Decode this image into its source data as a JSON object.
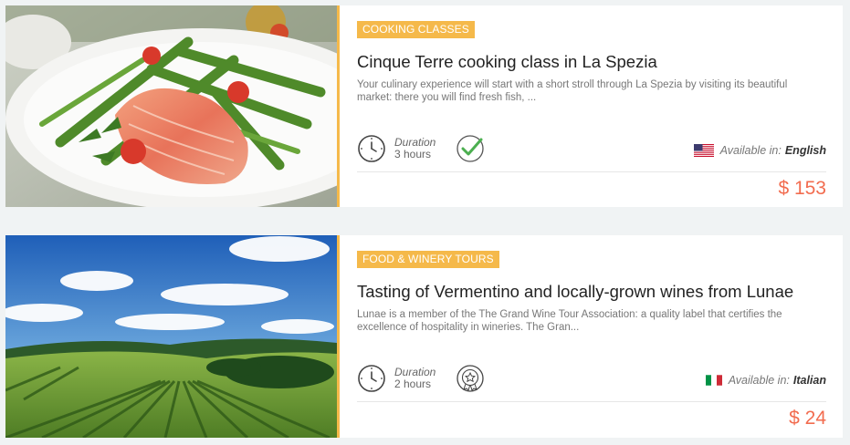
{
  "tours": [
    {
      "category": "COOKING CLASSES",
      "title": "Cinque Terre cooking class in La Spezia",
      "description": "Your culinary experience will start with a short stroll through La Spezia by visiting its beautiful market: there you will find fresh fish, ...",
      "duration_label": "Duration",
      "duration_value": "3 hours",
      "badge_icon": "check-circle-icon",
      "available_prefix": "Available in:",
      "language": "English",
      "flag": "us-flag-icon",
      "price": "$ 153"
    },
    {
      "category": "FOOD & WINERY TOURS",
      "title": "Tasting of Vermentino and locally-grown wines from Lunae",
      "description": "Lunae is a member of the The Grand Wine Tour Association: a quality label that certifies the excellence of hospitality in wineries. The Gran...",
      "duration_label": "Duration",
      "duration_value": "2 hours",
      "badge_icon": "award-medal-icon",
      "available_prefix": "Available in:",
      "language": "Italian",
      "flag": "italy-flag-icon",
      "price": "$ 24"
    }
  ],
  "colors": {
    "accent": "#f5b94a",
    "price": "#f26c4f",
    "check": "#4caf50"
  }
}
